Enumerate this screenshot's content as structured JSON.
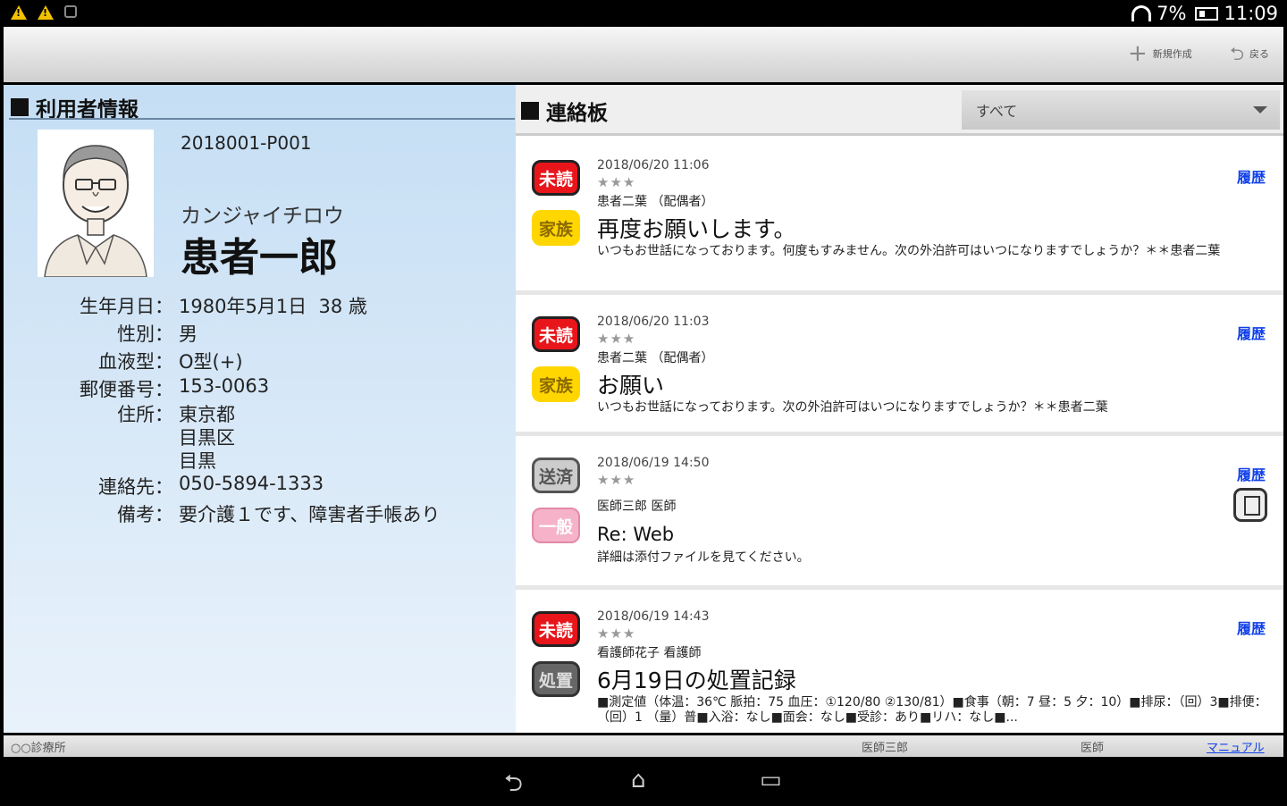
{
  "status_bar": {
    "battery": "7%",
    "time": "11:09"
  },
  "action_bar": {
    "new_label": "新規作成",
    "back_label": "戻る"
  },
  "patient": {
    "section_title": "利用者情報",
    "id": "2018001-P001",
    "kana": "カンジャイチロウ",
    "name": "患者一郎",
    "fields": [
      {
        "label": "生年月日：",
        "value": "1980年5月1日  38 歳"
      },
      {
        "label": "性別：",
        "value": "男"
      },
      {
        "label": "血液型：",
        "value": "O型(+)"
      },
      {
        "label": "郵便番号：",
        "value": "153-0063"
      },
      {
        "label": "住所：",
        "value": "東京都\n目黒区\n目黒"
      },
      {
        "label": "連絡先：",
        "value": "050-5894-1333"
      },
      {
        "label": "備考：",
        "value": "要介護１です、障害者手帳あり"
      }
    ]
  },
  "board": {
    "section_title": "連絡板",
    "filter_value": "すべて",
    "messages": [
      {
        "badge1": "未読",
        "badge2": "家族",
        "date": "2018/06/20  11:06",
        "stars": "★★★",
        "from": "患者二葉  （配偶者）",
        "subject": "再度お願いします。",
        "body": "いつもお世話になっております。何度もすみません。次の外泊許可はいつになりますでしょうか？＊＊患者二葉",
        "history": "履歴"
      },
      {
        "badge1": "未読",
        "badge2": "家族",
        "date": "2018/06/20  11:03",
        "stars": "★★★",
        "from": "患者二葉  （配偶者）",
        "subject": "お願い",
        "body": "いつもお世話になっております。次の外泊許可はいつになりますでしょうか？＊＊患者二葉",
        "history": "履歴"
      },
      {
        "badge1": "送済",
        "badge2": "一般",
        "date": "2018/06/19 14:50",
        "stars": "★★★",
        "from": "医師三郎 医師",
        "subject": "Re: Web",
        "body": "詳細は添付ファイルを見てください。",
        "history": "履歴"
      },
      {
        "badge1": "未読",
        "badge2": "処置",
        "date": "2018/06/19  14:43",
        "stars": "★★★",
        "from": "看護師花子    看護師",
        "subject": "6月19日の処置記録",
        "body": "■測定値（体温：36℃  脈拍：75  血圧：①120/80  ②130/81）■食事（朝：7  昼：5  夕：10）■排尿：（回）3■排便：（回）1  （量）普■入浴：なし■面会：なし■受診：あり■リハ：なし■...",
        "history": "履歴"
      }
    ]
  },
  "bottom_bar": {
    "facility": "○○診療所",
    "user": "医師三郎",
    "role": "医師",
    "manual_link": "マニュアル"
  }
}
